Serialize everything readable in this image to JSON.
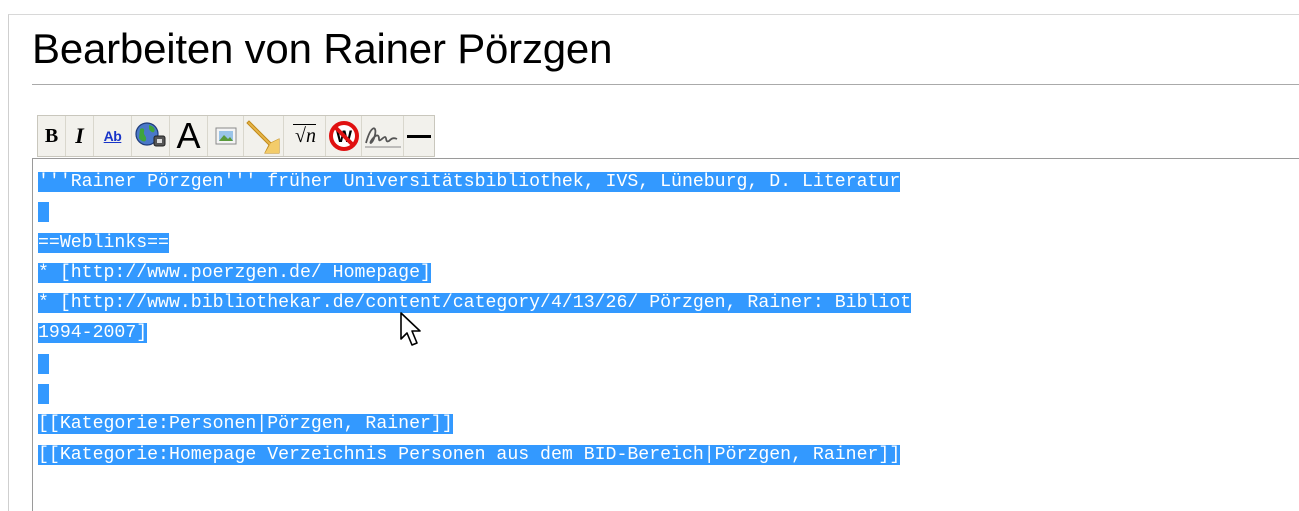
{
  "page": {
    "title": "Bearbeiten von Rainer Pörzgen"
  },
  "toolbar": {
    "buttons": [
      {
        "name": "bold-button",
        "label": "B",
        "icon": "bold-icon"
      },
      {
        "name": "italic-button",
        "label": "I",
        "icon": "italic-icon"
      },
      {
        "name": "internal-link-button",
        "label": "Ab",
        "icon": "internal-link-icon"
      },
      {
        "name": "external-link-button",
        "icon": "globe-link-icon"
      },
      {
        "name": "headline-button",
        "label": "A",
        "icon": "headline-icon"
      },
      {
        "name": "image-button",
        "icon": "image-icon"
      },
      {
        "name": "media-button",
        "icon": "media-horn-icon"
      },
      {
        "name": "math-button",
        "label": "√n",
        "icon": "math-formula-icon"
      },
      {
        "name": "nowiki-button",
        "label": "W",
        "icon": "nowiki-icon"
      },
      {
        "name": "signature-button",
        "icon": "signature-icon"
      },
      {
        "name": "horizontal-line-button",
        "icon": "horizontal-line-icon"
      }
    ]
  },
  "editor": {
    "lines": [
      "'''Rainer Pörzgen''' früher Universitätsbibliothek, IVS, Lüneburg, D. Literatur",
      "",
      "==Weblinks==",
      "* [http://www.poerzgen.de/ Homepage]",
      "* [http://www.bibliothekar.de/content/category/4/13/26/ Pörzgen, Rainer: Bibliot",
      "1994-2007]",
      "",
      "",
      "[[Kategorie:Personen|Pörzgen, Rainer]]",
      "[[Kategorie:Homepage Verzeichnis Personen aus dem BID-Bereich|Pörzgen, Rainer]]"
    ],
    "selection_color": "#3399ff"
  }
}
